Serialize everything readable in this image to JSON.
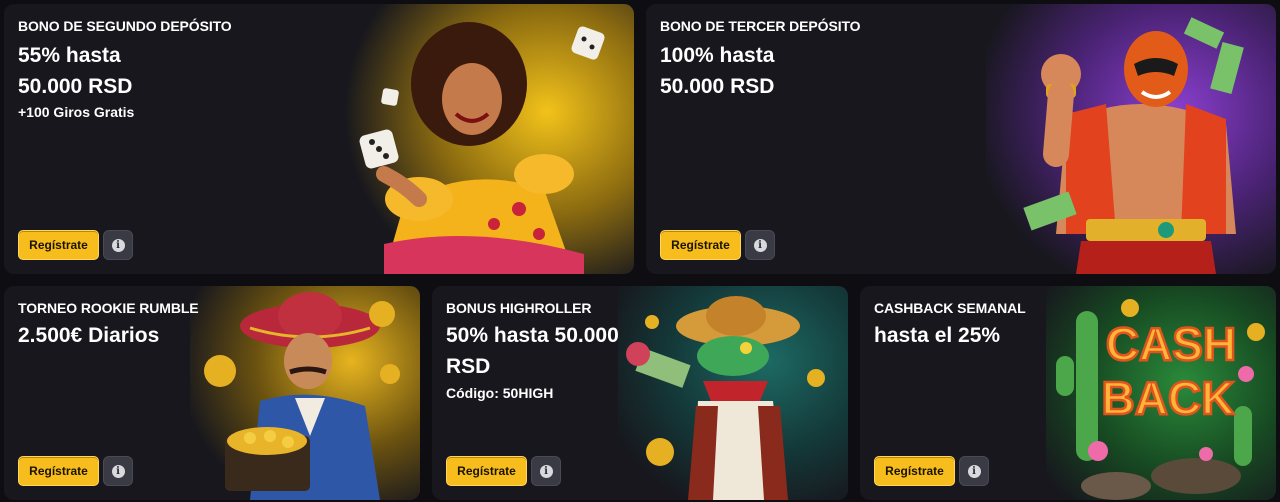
{
  "cards": [
    {
      "eyebrow": "BONO DE SEGUNDO DEPÓSITO",
      "headline_1": "55% hasta",
      "headline_2": "50.000 RSD",
      "subline": "+100 Giros Gratis",
      "register_label": "Regístrate",
      "info_glyph": "i",
      "art": "flamenco-dancer-with-dice",
      "accent": "#e0b021"
    },
    {
      "eyebrow": "BONO DE TERCER DEPÓSITO",
      "headline_1": "100% hasta",
      "headline_2": "50.000 RSD",
      "register_label": "Regístrate",
      "info_glyph": "i",
      "art": "luchador-wrestler-with-cash",
      "accent": "#7a3bb8"
    },
    {
      "eyebrow": "TORNEO ROOKIE RUMBLE",
      "headline_1": "2.500€ Diarios",
      "register_label": "Regístrate",
      "info_glyph": "i",
      "art": "mariachi-with-gold-chest",
      "accent": "#d9a21c"
    },
    {
      "eyebrow": "BONUS HIGHROLLER",
      "headline_1": "50% hasta 50.000",
      "headline_2": "RSD",
      "subline": "Código: 50HIGH",
      "register_label": "Regístrate",
      "info_glyph": "i",
      "art": "iguana-bandit-with-money",
      "accent": "#1f5a54"
    },
    {
      "eyebrow": "CASHBACK SEMANAL",
      "headline_1": "hasta el 25%",
      "register_label": "Regístrate",
      "info_glyph": "i",
      "art": "cactus-cashback-sign",
      "art_text_1": "CASH",
      "art_text_2": "BACK",
      "accent": "#1f6a2e"
    }
  ]
}
